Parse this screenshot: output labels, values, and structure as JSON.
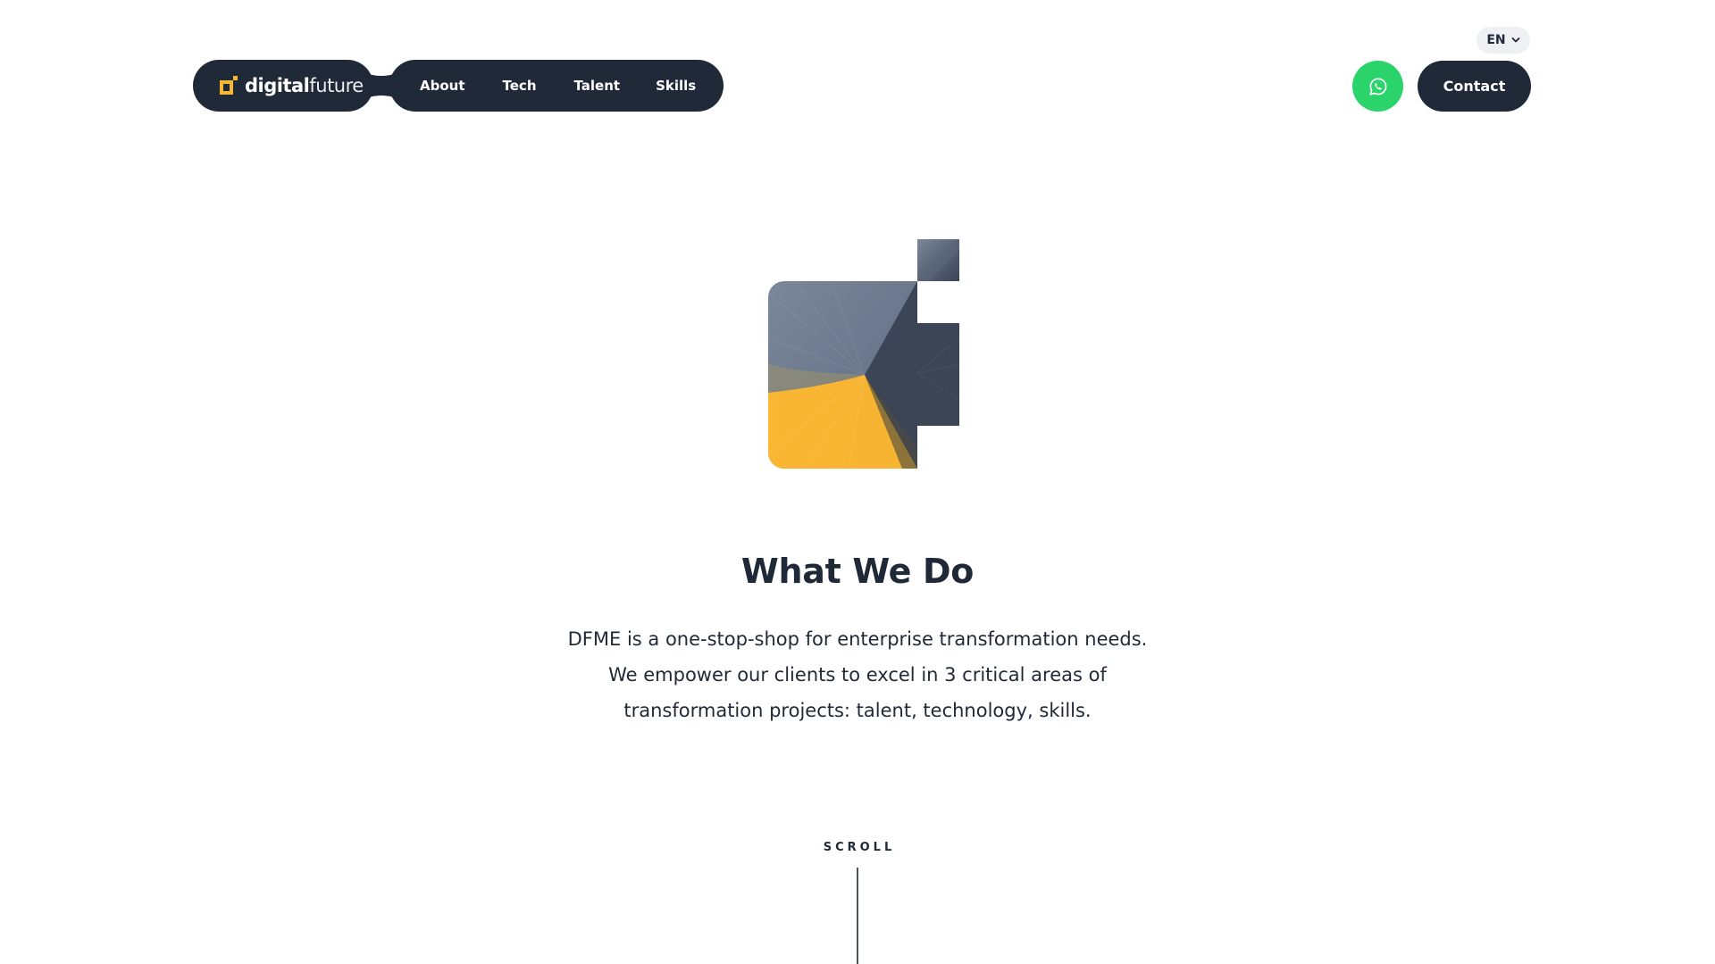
{
  "header": {
    "language": "EN",
    "logo": {
      "part1": "digital",
      "part2": "future"
    },
    "nav": [
      {
        "label": "About"
      },
      {
        "label": "Tech"
      },
      {
        "label": "Talent"
      },
      {
        "label": "Skills"
      }
    ],
    "contact_label": "Contact"
  },
  "icons": {
    "whatsapp": "whatsapp-icon",
    "chevron": "chevron-down-icon"
  },
  "main": {
    "heading": "What We Do",
    "body_lines": [
      "DFME is a one-stop-shop for enterprise transformation needs.",
      "We empower our clients to excel in 3 critical areas of",
      "transformation projects: talent, technology, skills."
    ],
    "scroll_label": "SCROLL"
  },
  "colors": {
    "dark": "#1f2937",
    "accent_yellow": "#f8b733",
    "whatsapp_green": "#2bd46a",
    "slate": "#6b7a90"
  }
}
